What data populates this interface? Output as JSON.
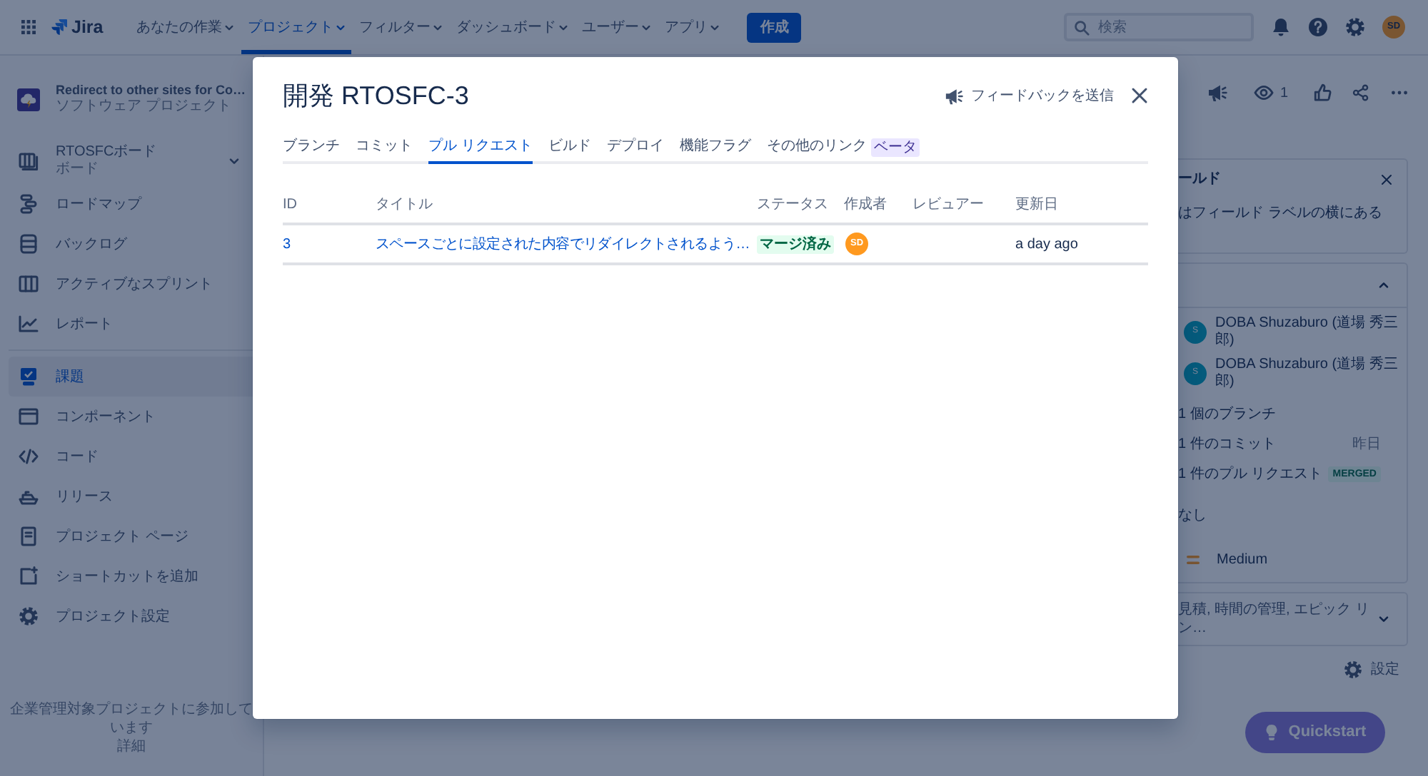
{
  "top_nav": {
    "product": "Jira",
    "menus": [
      {
        "label": "あなたの作業",
        "selected": false
      },
      {
        "label": "プロジェクト",
        "selected": true
      },
      {
        "label": "フィルター",
        "selected": false
      },
      {
        "label": "ダッシュボード",
        "selected": false
      },
      {
        "label": "ユーザー",
        "selected": false
      },
      {
        "label": "アプリ",
        "selected": false
      }
    ],
    "create_button": "作成",
    "search": {
      "placeholder": "検索"
    },
    "avatar": "SD"
  },
  "sidebar": {
    "project": {
      "name": "Redirect to other sites for Co…",
      "type": "ソフトウェア プロジェクト"
    },
    "sections": [
      {
        "items": [
          {
            "kind": "board",
            "label": "RTOSFCボード",
            "subtitle": "ボード",
            "selected": false
          },
          {
            "kind": "link",
            "label": "ロードマップ",
            "selected": false
          },
          {
            "kind": "link",
            "label": "バックログ",
            "selected": false
          },
          {
            "kind": "link",
            "label": "アクティブなスプリント",
            "selected": false
          },
          {
            "kind": "link",
            "label": "レポート",
            "selected": false
          }
        ]
      },
      {
        "items": [
          {
            "kind": "link",
            "label": "課題",
            "selected": true
          },
          {
            "kind": "link",
            "label": "コンポーネント",
            "selected": false
          },
          {
            "kind": "link",
            "label": "コード",
            "selected": false
          },
          {
            "kind": "link",
            "label": "リリース",
            "selected": false
          },
          {
            "kind": "link",
            "label": "プロジェクト ページ",
            "selected": false
          },
          {
            "kind": "link",
            "label": "ショートカットを追加",
            "selected": false
          },
          {
            "kind": "link",
            "label": "プロジェクト設定",
            "selected": false
          }
        ]
      }
    ],
    "footer": {
      "note": "企業管理対象プロジェクトに参加しています",
      "link": "詳細"
    }
  },
  "issue_panel": {
    "watchers": "1",
    "field_tip": {
      "title": "ールド",
      "text": "はフィールド ラベルの横にある"
    },
    "details": {
      "people": [
        {
          "avatar": "S",
          "name": "DOBA Shuzaburo (道場 秀三郎)"
        },
        {
          "avatar": "S",
          "name": "DOBA Shuzaburo (道場 秀三郎)"
        }
      ],
      "development": [
        {
          "label": "1 個のブランチ"
        },
        {
          "label": "1 件のコミット",
          "meta": "昨日"
        },
        {
          "label": "1 件のプル リクエスト",
          "badge": "MERGED"
        }
      ],
      "value": "なし",
      "priority": "Medium"
    },
    "more_fields": "見積, 時間の管理, エピック リン…",
    "settings": "設定"
  },
  "quickstart": "Quickstart",
  "modal": {
    "title": "開発 RTOSFC-3",
    "feedback": "フィードバックを送信",
    "tabs": [
      {
        "label": "ブランチ",
        "selected": false
      },
      {
        "label": "コミット",
        "selected": false
      },
      {
        "label": "プル リクエスト",
        "selected": true
      },
      {
        "label": "ビルド",
        "selected": false
      },
      {
        "label": "デプロイ",
        "selected": false
      },
      {
        "label": "機能フラグ",
        "selected": false
      },
      {
        "label": "その他のリンク",
        "badge": "ベータ",
        "selected": false
      }
    ],
    "table": {
      "columns": [
        "ID",
        "タイトル",
        "ステータス",
        "作成者",
        "レビュアー",
        "更新日"
      ],
      "rows": [
        {
          "id": "3",
          "title": "スペースごとに設定された内容でリダイレクトされるよう…",
          "status": "マージ済み",
          "author": "SD",
          "updated": "a day ago"
        }
      ]
    }
  }
}
